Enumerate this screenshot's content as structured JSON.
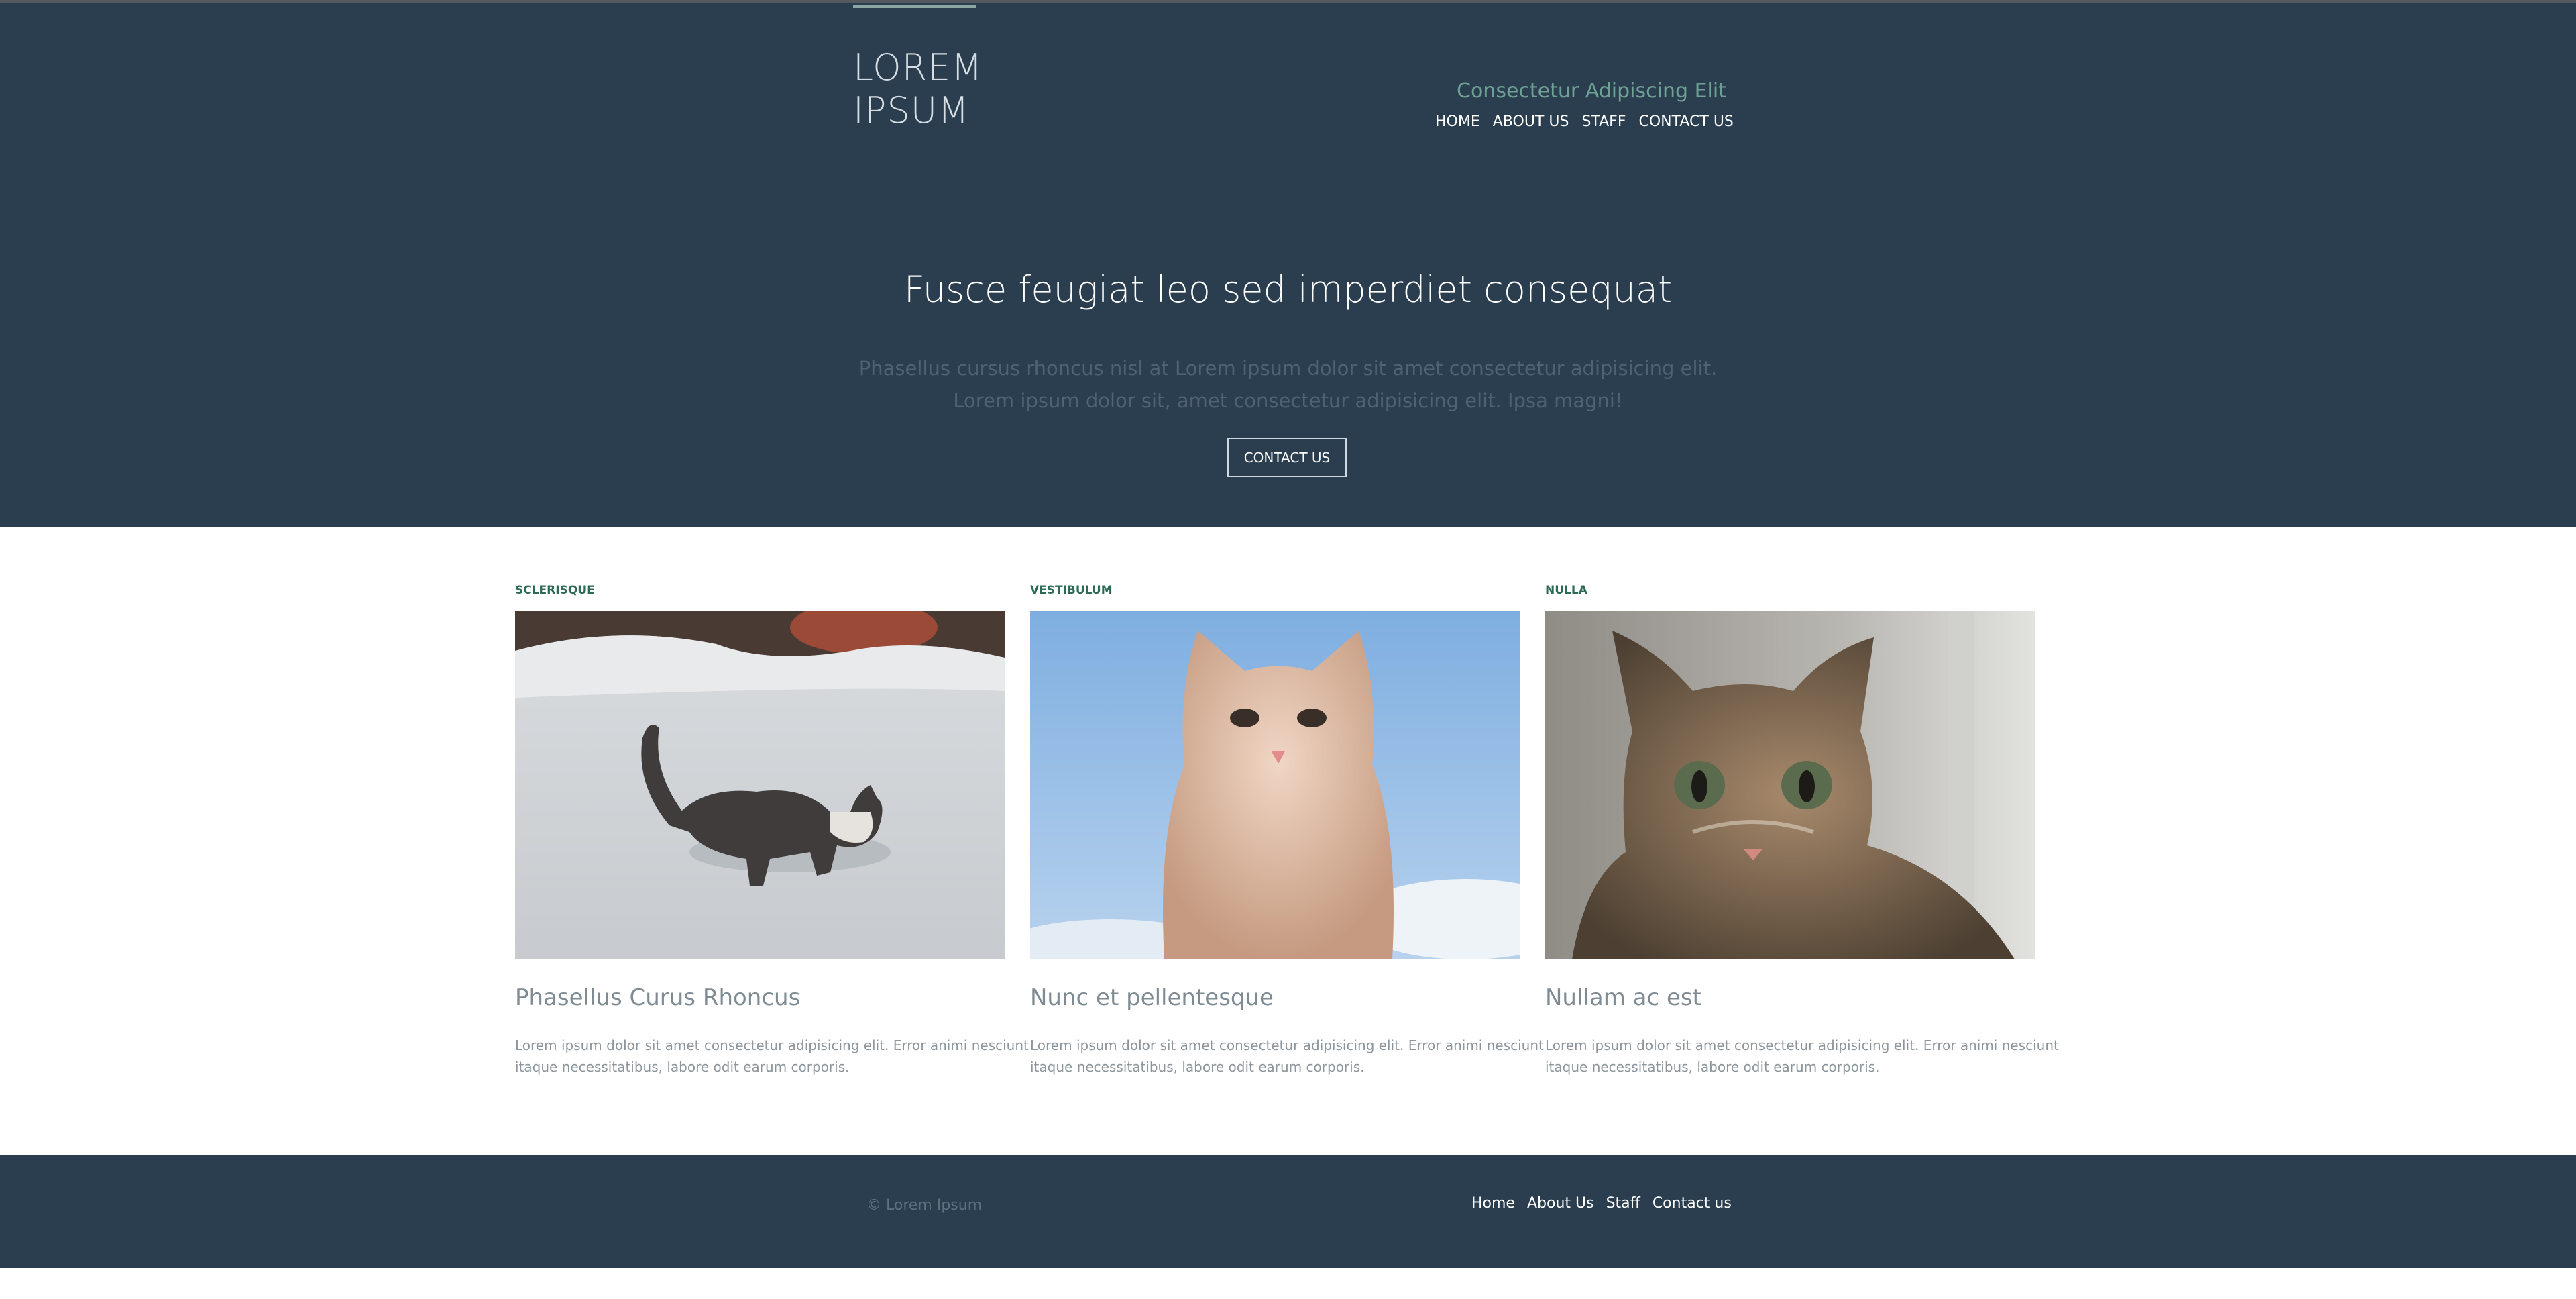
{
  "header": {
    "logo_line1": "LOREM",
    "logo_line2": "IPSUM",
    "tagline": "Consectetur Adipiscing Elit",
    "nav": [
      "HOME",
      "ABOUT US",
      "STAFF",
      "CONTACT US"
    ]
  },
  "hero": {
    "title": "Fusce feugiat leo sed imperdiet consequat",
    "text_line1": "Phasellus cursus rhoncus nisl at Lorem ipsum dolor sit amet consectetur adipisicing elit.",
    "text_line2": "Lorem ipsum dolor sit, amet consectetur adipisicing elit. Ipsa magni!",
    "button": "CONTACT US"
  },
  "cards": [
    {
      "label": "SCLERISQUE",
      "image": "kitten-in-snow",
      "title": "Phasellus Curus Rhoncus",
      "desc": "Lorem ipsum dolor sit amet consectetur adipisicing elit. Error animi nesciunt itaque necessitatibus, labore odit earum corporis."
    },
    {
      "label": "VESTIBULUM",
      "image": "white-kitten-sky",
      "title": "Nunc et pellentesque",
      "desc": "Lorem ipsum dolor sit amet consectetur adipisicing elit. Error animi nesciunt itaque necessitatibus, labore odit earum corporis."
    },
    {
      "label": "NULLA",
      "image": "tabby-kitten",
      "title": "Nullam ac est",
      "desc": "Lorem ipsum dolor sit amet consectetur adipisicing elit. Error animi nesciunt itaque necessitatibus, labore odit earum corporis."
    }
  ],
  "footer": {
    "copyright": "© Lorem Ipsum",
    "nav": [
      "Home",
      "About Us",
      "Staff",
      "Contact us"
    ]
  },
  "colors": {
    "header_bg": "#2b3e50",
    "accent": "#6fa094",
    "label": "#2d6b55"
  }
}
